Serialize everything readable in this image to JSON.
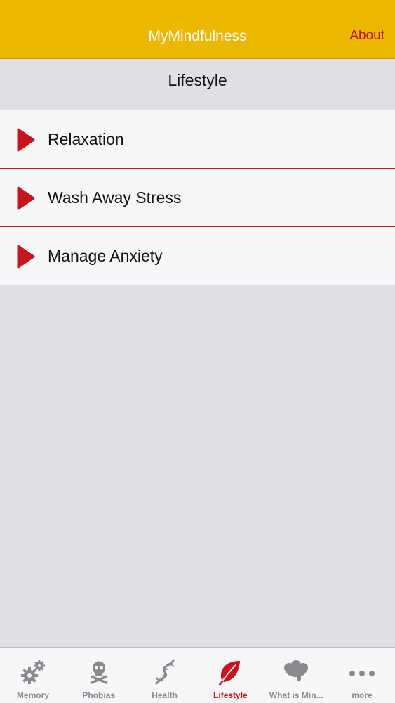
{
  "navbar": {
    "title": "MyMindfulness",
    "about_label": "About"
  },
  "section": {
    "title": "Lifestyle"
  },
  "list": {
    "items": [
      {
        "label": "Relaxation",
        "icon": "play-icon"
      },
      {
        "label": "Wash Away Stress",
        "icon": "play-icon"
      },
      {
        "label": "Manage Anxiety",
        "icon": "play-icon"
      }
    ]
  },
  "tabbar": {
    "tabs": [
      {
        "label": "Memory",
        "icon": "gears-icon",
        "active": false
      },
      {
        "label": "Phobias",
        "icon": "skull-crossbones-icon",
        "active": false
      },
      {
        "label": "Health",
        "icon": "dna-icon",
        "active": false
      },
      {
        "label": "Lifestyle",
        "icon": "leaf-icon",
        "active": true
      },
      {
        "label": "What is Min...",
        "icon": "brain-icon",
        "active": false
      },
      {
        "label": "more",
        "icon": "more-dots-icon",
        "active": false
      }
    ]
  },
  "colors": {
    "navbar": "#ebb700",
    "accent": "#c4161c",
    "background": "#e0dfe3",
    "cell": "#f7f7f9",
    "inactive_tab": "#8a8a8e"
  }
}
